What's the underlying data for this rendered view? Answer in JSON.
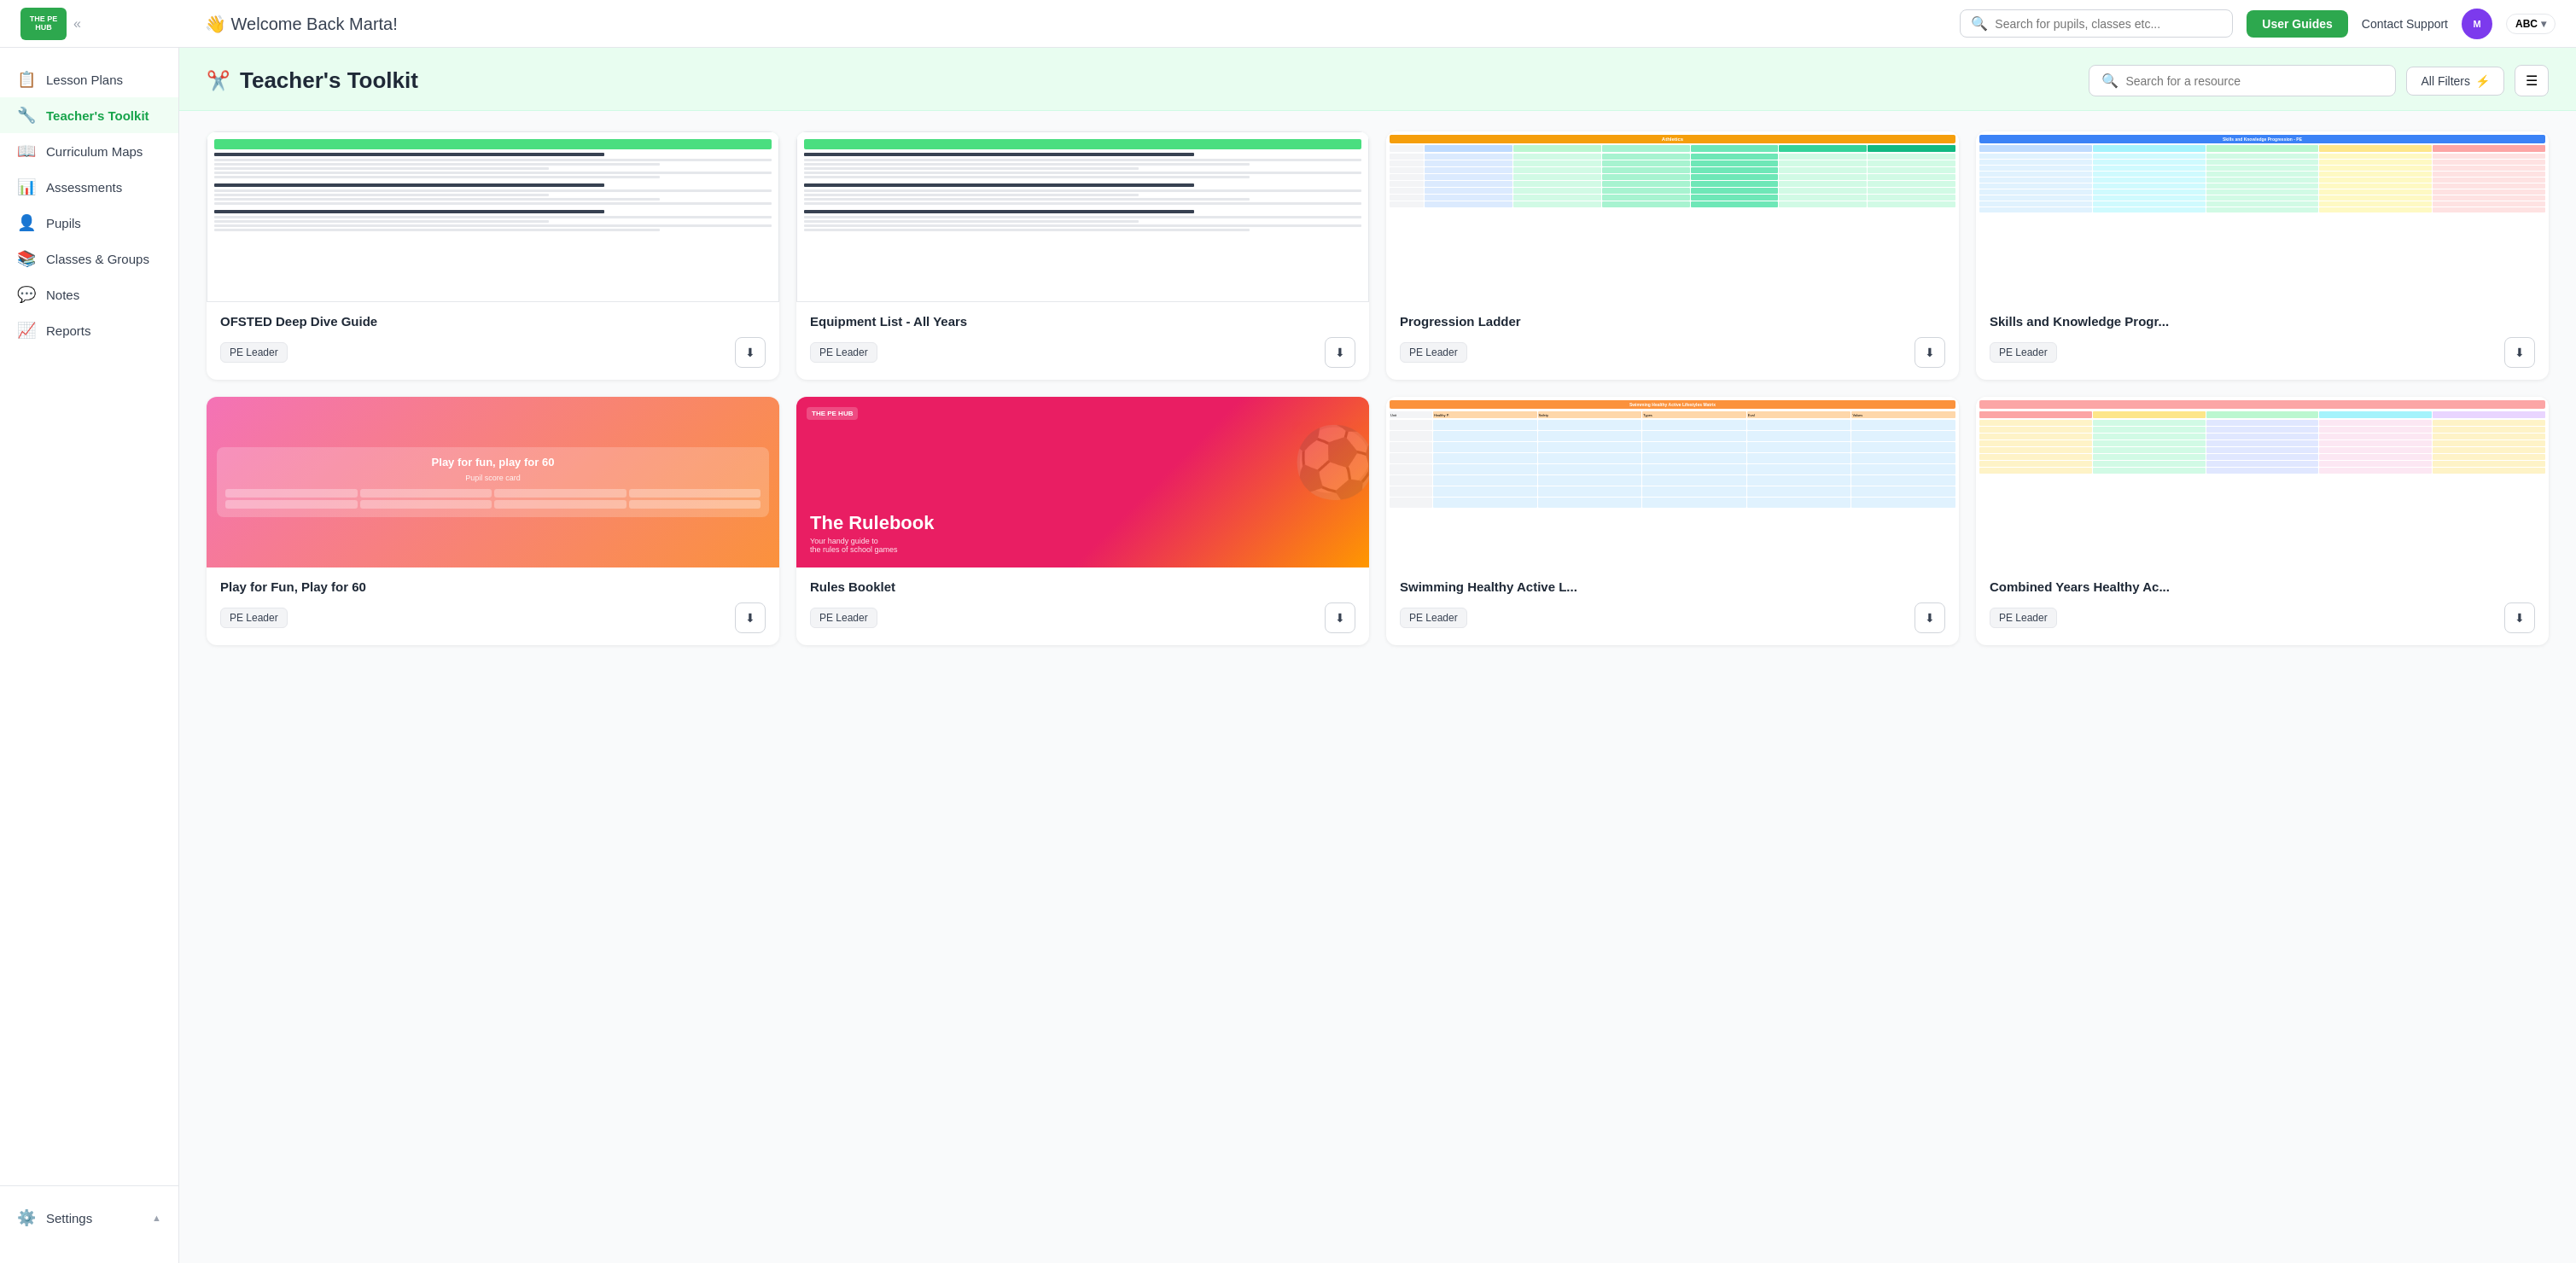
{
  "topnav": {
    "logo_text": "THE PE HUB",
    "welcome": "👋 Welcome Back Marta!",
    "search_placeholder": "Search for pupils, classes etc...",
    "user_guides_label": "User Guides",
    "contact_support_label": "Contact Support",
    "account_label": "ABC",
    "collapse_icon": "«"
  },
  "sidebar": {
    "items": [
      {
        "label": "Lesson Plans",
        "icon": "📋",
        "active": false
      },
      {
        "label": "Teacher's Toolkit",
        "icon": "🔧",
        "active": true
      },
      {
        "label": "Curriculum Maps",
        "icon": "📖",
        "active": false
      },
      {
        "label": "Assessments",
        "icon": "📊",
        "active": false
      },
      {
        "label": "Pupils",
        "icon": "👤",
        "active": false
      },
      {
        "label": "Classes & Groups",
        "icon": "📚",
        "active": false
      },
      {
        "label": "Notes",
        "icon": "💬",
        "active": false
      },
      {
        "label": "Reports",
        "icon": "📈",
        "active": false
      }
    ],
    "settings_label": "Settings",
    "settings_icon": "⚙️"
  },
  "page": {
    "title": "Teacher's Toolkit",
    "title_icon": "✂️",
    "search_placeholder": "Search for a resource",
    "filter_label": "All Filters",
    "filter_icon": "▼"
  },
  "cards": [
    {
      "id": "ofsted",
      "title": "OFSTED Deep Dive Guide",
      "tag": "PE Leader",
      "preview_type": "document",
      "color": "light-teal"
    },
    {
      "id": "equipment",
      "title": "Equipment List - All Years",
      "tag": "PE Leader",
      "preview_type": "document",
      "color": "teal"
    },
    {
      "id": "progression",
      "title": "Progression Ladder",
      "tag": "PE Leader",
      "preview_type": "athletics",
      "color": "white-bg"
    },
    {
      "id": "skills",
      "title": "Skills and Knowledge Progr...",
      "tag": "PE Leader",
      "preview_type": "skills",
      "color": "peach"
    },
    {
      "id": "play60",
      "title": "Play for Fun, Play for 60",
      "tag": "PE Leader",
      "preview_type": "play",
      "color": "pink"
    },
    {
      "id": "rulebook",
      "title": "Rules Booklet",
      "tag": "PE Leader",
      "preview_type": "rulebook",
      "color": "pink"
    },
    {
      "id": "swimming",
      "title": "Swimming Healthy Active L...",
      "tag": "PE Leader",
      "preview_type": "swimming",
      "color": "peach"
    },
    {
      "id": "combined",
      "title": "Combined Years Healthy Ac...",
      "tag": "PE Leader",
      "preview_type": "combined",
      "color": "peach"
    }
  ],
  "download_icon": "⬇"
}
